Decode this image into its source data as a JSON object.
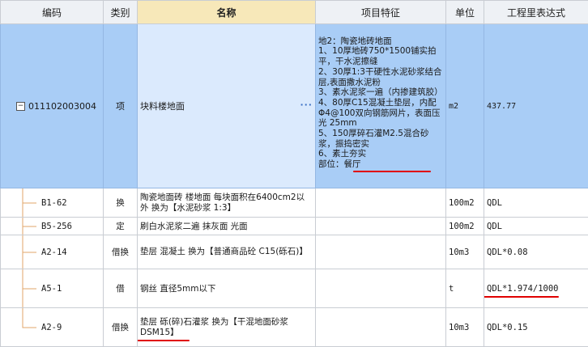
{
  "headers": {
    "code": "编码",
    "type": "类别",
    "name": "名称",
    "feature": "项目特征",
    "unit": "单位",
    "expr": "工程里表达式"
  },
  "main_row": {
    "code": "011102003004",
    "type": "项",
    "name": "块料楼地面",
    "ellipsis": "···",
    "feature": "地2：陶瓷地砖地面\n1、10厚地砖750*1500铺实拍平，干水泥擦缝\n2、30厚1:3干硬性水泥砂浆结合层,表面撒水泥粉\n3、素水泥浆一遍（内掺建筑胶）\n4、80厚C15混凝土垫层，内配Φ4@100双向钢筋网片，表面压光 25mm\n5、150厚碎石灌M2.5混合砂浆，振捣密实\n6、素土夯实\n部位：餐厅",
    "unit": "m2",
    "expr": "437.77"
  },
  "sub_rows": [
    {
      "code": "B1-62",
      "type": "换",
      "name": "陶瓷地面砖 楼地面 每块面积在6400cm2以外  换为【水泥砂浆 1:3】",
      "unit": "100m2",
      "expr": "QDL"
    },
    {
      "code": "B5-256",
      "type": "定",
      "name": "刷白水泥浆二遍 抹灰面 光面",
      "unit": "100m2",
      "expr": "QDL"
    },
    {
      "code": "A2-14",
      "type": "借换",
      "name": "垫层 混凝土  换为【普通商品砼 C15(砾石)】",
      "unit": "10m3",
      "expr": "QDL*0.08"
    },
    {
      "code": "A5-1",
      "type": "借",
      "name": "钢丝 直径5mm以下",
      "unit": "t",
      "expr": "QDL*1.974/1000"
    },
    {
      "code": "A2-9",
      "type": "借换",
      "name": "垫层 砾(碎)石灌浆  换为【干混地面砂浆 DSM15】",
      "unit": "10m3",
      "expr": "QDL*0.15"
    }
  ],
  "colors": {
    "selected_row": "#a9cdf6",
    "name_cell": "#dbeafd",
    "header_highlight": "#f7e8b9",
    "annotation": "#e00000"
  }
}
